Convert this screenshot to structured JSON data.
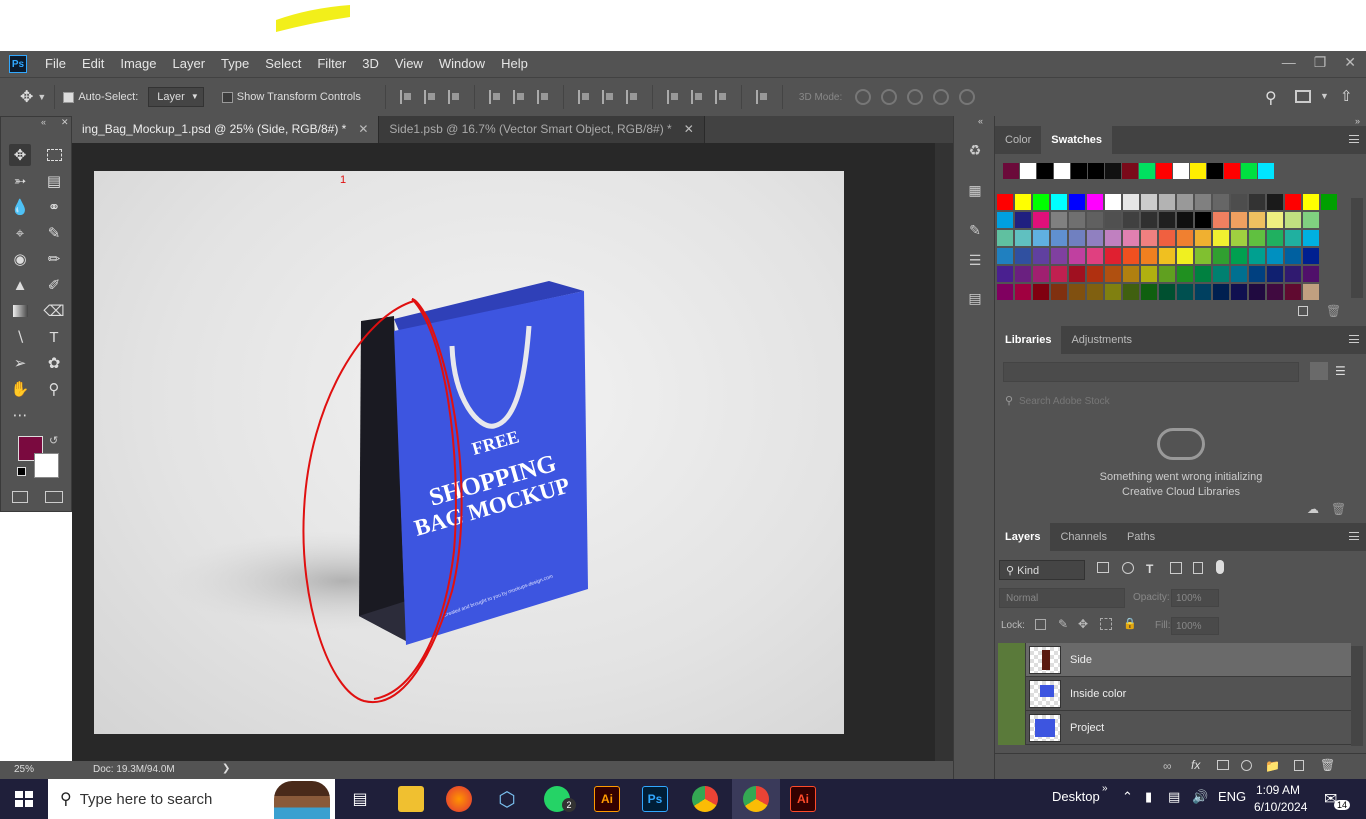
{
  "app": {
    "logo": "Ps"
  },
  "menu": [
    "File",
    "Edit",
    "Image",
    "Layer",
    "Type",
    "Select",
    "Filter",
    "3D",
    "View",
    "Window",
    "Help"
  ],
  "options": {
    "auto_select_label": "Auto-Select:",
    "auto_select_value": "Layer",
    "transform_label": "Show Transform Controls",
    "mode_3d_label": "3D Mode:"
  },
  "tabs": [
    {
      "label": "ing_Bag_Mockup_1.psd @ 25% (Side, RGB/8#) *",
      "active": true
    },
    {
      "label": "Side1.psb @ 16.7% (Vector Smart Object, RGB/8#) *",
      "active": false
    }
  ],
  "canvas": {
    "annotation_mark": "1",
    "bag_title_line1": "FREE",
    "bag_title_line2": "SHOPPING",
    "bag_title_line3": "BAG MOCKUP",
    "bag_footer": "Created and brought to you by mockups-design.com"
  },
  "status": {
    "zoom": "25%",
    "doc": "Doc: 19.3M/94.0M"
  },
  "colors": {
    "foreground": "#7a0a3f",
    "background": "#ffffff",
    "bag_blue": "#3d55e0"
  },
  "panels": {
    "color_tab": "Color",
    "swatches_tab": "Swatches",
    "libraries_tab": "Libraries",
    "adjustments_tab": "Adjustments",
    "library_search_placeholder": "Search Adobe Stock",
    "library_error_line1": "Something went wrong initializing",
    "library_error_line2": "Creative Cloud Libraries",
    "layers_tab": "Layers",
    "channels_tab": "Channels",
    "paths_tab": "Paths",
    "filter_kind": "Kind",
    "blend_mode": "Normal",
    "opacity_label": "Opacity:",
    "opacity_value": "100%",
    "lock_label": "Lock:",
    "fill_label": "Fill:",
    "fill_value": "100%"
  },
  "layers": [
    {
      "name": "Side",
      "selected": true
    },
    {
      "name": "Inside color",
      "selected": false
    },
    {
      "name": "Project",
      "selected": false
    }
  ],
  "taskbar": {
    "search_placeholder": "Type here to search",
    "desktop_label": "Desktop",
    "language": "ENG",
    "time": "1:09 AM",
    "date": "6/10/2024",
    "notifications": "14",
    "whatsapp_badge": "2",
    "apps": [
      "task-view",
      "file-explorer",
      "firefox",
      "virtualbox",
      "whatsapp",
      "illustrator",
      "photoshop",
      "chrome",
      "chrome-profile",
      "illustrator-active"
    ]
  },
  "swatches_recent": [
    "#6b0a3a",
    "#ffffff",
    "#000000",
    "#ffffff",
    "#000000",
    "#000000",
    "#111111",
    "#7a0a1a",
    "#00e060",
    "#ff0000",
    "#ffffff",
    "#ffee00",
    "#000000",
    "#ff0000",
    "#00e040",
    "#00e5ff"
  ]
}
